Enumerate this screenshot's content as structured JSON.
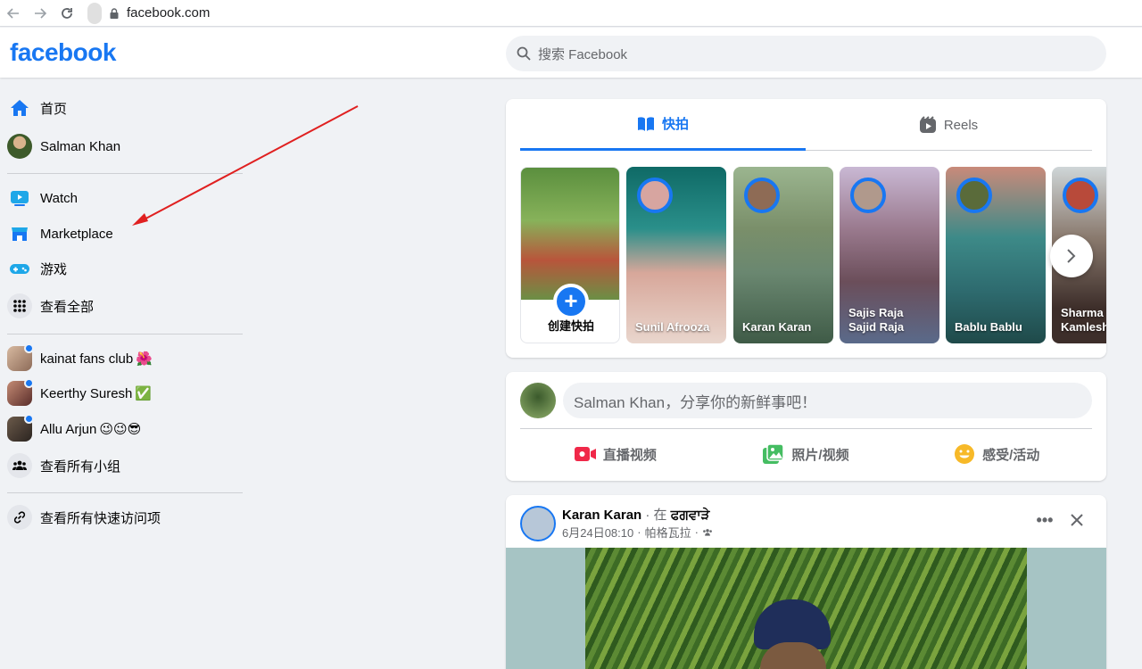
{
  "browser": {
    "url": "facebook.com"
  },
  "header": {
    "logo": "facebook",
    "search_placeholder": "搜索 Facebook"
  },
  "sidebar": {
    "items": [
      {
        "label": "首页",
        "icon": "home-icon"
      },
      {
        "label": "Salman Khan",
        "icon": "profile-avatar"
      },
      {
        "label": "Watch",
        "icon": "watch-icon"
      },
      {
        "label": "Marketplace",
        "icon": "marketplace-icon"
      },
      {
        "label": "游戏",
        "icon": "gaming-icon"
      },
      {
        "label": "查看全部",
        "icon": "grid-icon"
      }
    ],
    "groups": [
      {
        "label": "kainat fans club",
        "emoji": "🌺"
      },
      {
        "label": "Keerthy Suresh",
        "emoji": "✅"
      },
      {
        "label": "Allu Arjun",
        "emoji": "😉😉😎"
      },
      {
        "label": "查看所有小组",
        "icon": "groups-icon"
      }
    ],
    "shortcuts": [
      {
        "label": "查看所有快速访问项",
        "icon": "link-icon"
      }
    ]
  },
  "stories": {
    "tabs": {
      "stories": "快拍",
      "reels": "Reels"
    },
    "create_label": "创建快拍",
    "items": [
      {
        "name": "Sunil Afrooza"
      },
      {
        "name": "Karan Karan"
      },
      {
        "name": "Sajis Raja Sajid Raja"
      },
      {
        "name": "Bablu Bablu"
      },
      {
        "name": "Sharma Kamlesh"
      }
    ]
  },
  "composer": {
    "placeholder": "Salman Khan，分享你的新鲜事吧！",
    "actions": {
      "live": "直播视频",
      "photo": "照片/视频",
      "feeling": "感受/活动"
    }
  },
  "post": {
    "author": "Karan Karan",
    "at_prefix": "· 在",
    "location": "ਫਗਵਾੜੇ",
    "date": "6月24日08:10",
    "place": "帕格瓦拉",
    "dot": "·"
  },
  "colors": {
    "brand": "#1877f2",
    "background": "#f0f2f5",
    "annotation_arrow": "#e02020"
  }
}
